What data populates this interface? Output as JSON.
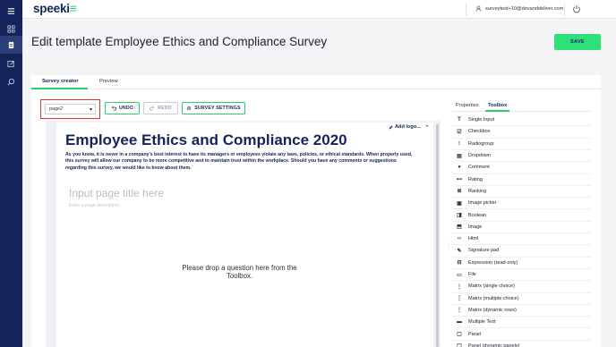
{
  "app": {
    "logo": "speeki",
    "logo_mark": "≡"
  },
  "topbar": {
    "user_email": "surveytest+10@devanddeliver.com"
  },
  "nav": {
    "items": [
      "apps-icon",
      "survey-icon",
      "edit-icon",
      "search-icon"
    ]
  },
  "header": {
    "title": "Edit template Employee Ethics and Compliance Survey",
    "save_label": "SAVE"
  },
  "tabs": {
    "survey_creator": "Survey creator",
    "preview": "Preview"
  },
  "toolbar": {
    "page_select": "page2",
    "undo_label": "UNDO",
    "redo_label": "REDO",
    "settings_label": "SURVEY SETTINGS"
  },
  "survey": {
    "add_logo": "Add logo...",
    "title": "Employee Ethics and Compliance 2020",
    "description": "As you know, it is never in a company's best interest to have its managers or employees violate any laws, policies, or ethical standards. When properly used, this survey will allow our company to be more competitive and to maintain trust within the workplace. Should you have any comments or suggestions regarding this survey, we would like to know about them.",
    "page_title_placeholder": "Input page title here",
    "page_desc_placeholder": "Enter a page description",
    "drop_hint": "Please drop a question here from the Toolbox."
  },
  "right_panel": {
    "tab_properties": "Properties",
    "tab_toolbox": "Toolbox",
    "tools": [
      {
        "label": "Single Input",
        "icon": "text-icon"
      },
      {
        "label": "Checkbox",
        "icon": "checkbox-icon"
      },
      {
        "label": "Radiogroup",
        "icon": "radiogroup-icon"
      },
      {
        "label": "Dropdown",
        "icon": "dropdown-icon"
      },
      {
        "label": "Comment",
        "icon": "comment-icon"
      },
      {
        "label": "Rating",
        "icon": "rating-icon"
      },
      {
        "label": "Ranking",
        "icon": "ranking-icon"
      },
      {
        "label": "Image picker",
        "icon": "image-picker-icon"
      },
      {
        "label": "Boolean",
        "icon": "boolean-icon"
      },
      {
        "label": "Image",
        "icon": "image-icon"
      },
      {
        "label": "Html",
        "icon": "html-icon"
      },
      {
        "label": "Signature pad",
        "icon": "signature-icon"
      },
      {
        "label": "Expression (read-only)",
        "icon": "expression-icon"
      },
      {
        "label": "File",
        "icon": "file-icon"
      },
      {
        "label": "Matrix (single choice)",
        "icon": "matrix-single-icon"
      },
      {
        "label": "Matrix (multiple choice)",
        "icon": "matrix-multiple-icon"
      },
      {
        "label": "Matrix (dynamic rows)",
        "icon": "matrix-dynamic-icon"
      },
      {
        "label": "Multiple Text",
        "icon": "multiple-text-icon"
      },
      {
        "label": "Panel",
        "icon": "panel-icon"
      },
      {
        "label": "Panel (dynamic panels)",
        "icon": "panel-dynamic-icon"
      }
    ]
  },
  "colors": {
    "navy": "#14245a",
    "accent": "#2ee07a",
    "highlight": "#d9352f"
  }
}
